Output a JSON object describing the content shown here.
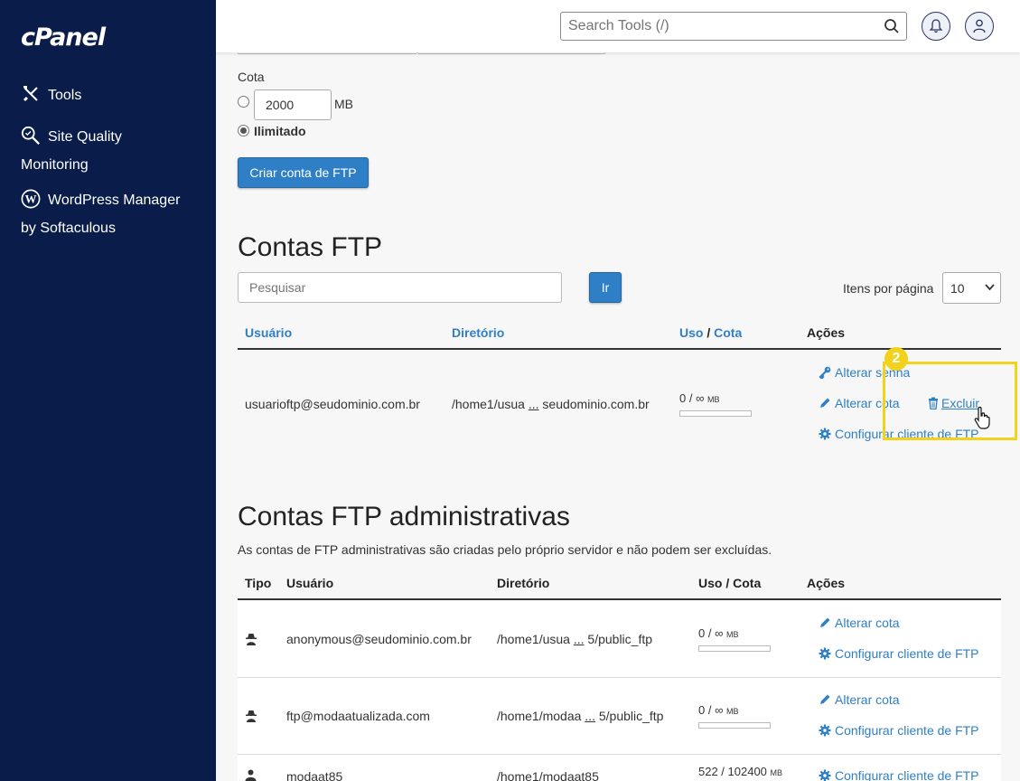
{
  "sidebar": {
    "logo": "cPanel",
    "items": [
      {
        "label": "Tools",
        "icon": "tools-icon"
      },
      {
        "label": "Site Quality",
        "label2": "Monitoring",
        "icon": "site-quality-icon"
      },
      {
        "label": "WordPress Manager",
        "label2": "by Softaculous",
        "icon": "wordpress-icon"
      }
    ]
  },
  "topbar": {
    "search_placeholder": "Search Tools (/)"
  },
  "quota": {
    "label": "Cota",
    "value": "2000",
    "unit": "MB",
    "unlimited_label": "Ilimitado",
    "selected": "unlimited"
  },
  "create_button": "Criar conta de FTP",
  "ftp_accounts": {
    "title": "Contas FTP",
    "search_placeholder": "Pesquisar",
    "go_button": "Ir",
    "per_page_label": "Itens por página",
    "per_page_value": "10",
    "headers": {
      "user": "Usuário",
      "dir": "Diretório",
      "usage": "Uso",
      "sep": "/",
      "quota": "Cota",
      "actions": "Ações"
    },
    "rows": [
      {
        "user": "usuarioftp@seudominio.com.br",
        "dir_start": "/home1/usua",
        "dir_ellipsis": "...",
        "dir_end": "seudominio.com.br",
        "usage": "0 / ∞",
        "usage_unit": "MB",
        "actions": {
          "change_password": "Alterar senha",
          "change_quota": "Alterar cota",
          "delete": "Excluir",
          "configure": "Configurar cliente de FTP"
        }
      }
    ]
  },
  "annotation": {
    "step": "2",
    "color": "#f2d21a"
  },
  "admin_accounts": {
    "title": "Contas FTP administrativas",
    "description": "As contas de FTP administrativas são criadas pelo próprio servidor e não podem ser excluídas.",
    "headers": {
      "type": "Tipo",
      "user": "Usuário",
      "dir": "Diretório",
      "usage": "Uso / Cota",
      "actions": "Ações"
    },
    "rows": [
      {
        "type_icon": "anonymous-icon",
        "user": "anonymous@seudominio.com.br",
        "dir_start": "/home1/usua",
        "dir_ellipsis": "...",
        "dir_end": "5/public_ftp",
        "usage": "0 / ∞",
        "usage_unit": "MB",
        "action1": "Alterar cota",
        "action2": "Configurar cliente de FTP"
      },
      {
        "type_icon": "anonymous-icon",
        "user": "ftp@modaatualizada.com",
        "dir_start": "/home1/modaa",
        "dir_ellipsis": "...",
        "dir_end": "5/public_ftp",
        "usage": "0 / ∞",
        "usage_unit": "MB",
        "action1": "Alterar cota",
        "action2": "Configurar cliente de FTP"
      },
      {
        "type_icon": "user-icon",
        "user": "modaat85",
        "dir_start": "/home1/modaat85",
        "usage": "522 / 102400",
        "usage_unit": "MB",
        "action2": "Configurar cliente de FTP"
      }
    ]
  },
  "colors": {
    "sidebar": "#0a1d4a",
    "link": "#2f7fc6",
    "button": "#2f7fc6"
  }
}
